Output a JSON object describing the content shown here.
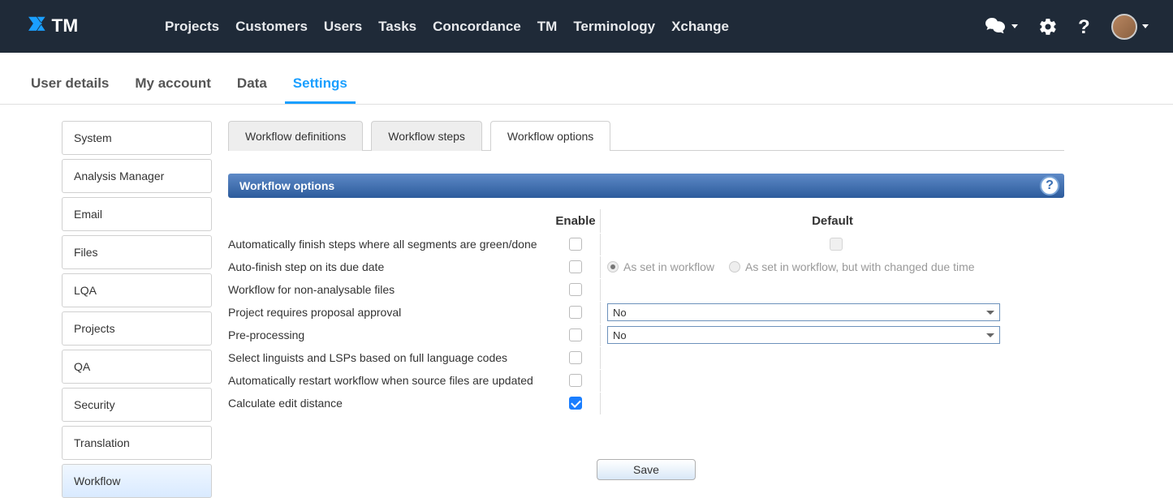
{
  "topnav": {
    "items": [
      "Projects",
      "Customers",
      "Users",
      "Tasks",
      "Concordance",
      "TM",
      "Terminology",
      "Xchange"
    ]
  },
  "subtabs": {
    "items": [
      "User details",
      "My account",
      "Data",
      "Settings"
    ],
    "active_index": 3
  },
  "sidebar": {
    "items": [
      "System",
      "Analysis Manager",
      "Email",
      "Files",
      "LQA",
      "Projects",
      "QA",
      "Security",
      "Translation",
      "Workflow"
    ],
    "active_index": 9
  },
  "tabs": {
    "items": [
      "Workflow definitions",
      "Workflow steps",
      "Workflow options"
    ],
    "active_index": 2
  },
  "panel": {
    "title": "Workflow options"
  },
  "columns": {
    "label": "",
    "enable": "Enable",
    "default": "Default"
  },
  "options": {
    "row0": {
      "label": "Automatically finish steps where all segments are green/done",
      "enabled": false
    },
    "row1": {
      "label": "Auto-finish step on its due date",
      "enabled": false,
      "radio0": "As set in workflow",
      "radio1": "As set in workflow, but with changed due time"
    },
    "row2": {
      "label": "Workflow for non-analysable files",
      "enabled": false
    },
    "row3": {
      "label": "Project requires proposal approval",
      "enabled": false,
      "default": "No"
    },
    "row4": {
      "label": "Pre-processing",
      "enabled": false,
      "default": "No"
    },
    "row5": {
      "label": "Select linguists and LSPs based on full language codes",
      "enabled": false
    },
    "row6": {
      "label": "Automatically restart workflow when source files are updated",
      "enabled": false
    },
    "row7": {
      "label": "Calculate edit distance",
      "enabled": true
    }
  },
  "buttons": {
    "save": "Save"
  }
}
